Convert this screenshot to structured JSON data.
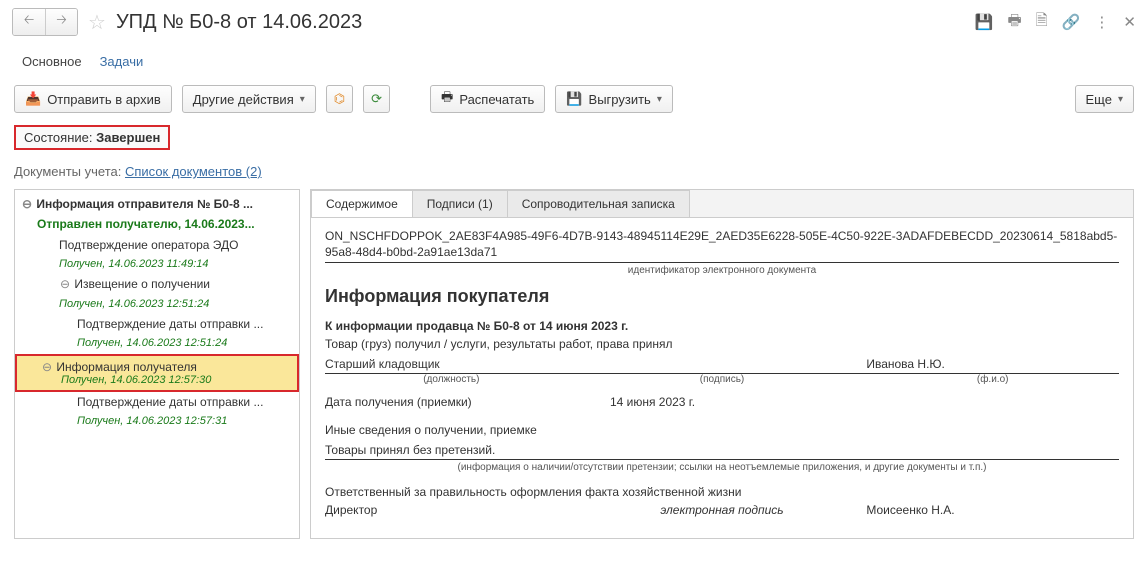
{
  "header": {
    "title": "УПД № Б0-8 от 14.06.2023"
  },
  "navtabs": {
    "main": "Основное",
    "tasks": "Задачи"
  },
  "toolbar": {
    "archive": "Отправить в архив",
    "other": "Другие действия",
    "print": "Распечатать",
    "export": "Выгрузить",
    "more": "Еще"
  },
  "status": {
    "label": "Состояние:",
    "value": "Завершен"
  },
  "docs": {
    "label": "Документы учета:",
    "link": "Список документов (2)"
  },
  "tree": {
    "root": "Информация отправителя № Б0-8 ...",
    "sent": "Отправлен получателю, 14.06.2023...",
    "n1": "Подтверждение оператора ЭДО",
    "n1s": "Получен, 14.06.2023 11:49:14",
    "n2": "Извещение о получении",
    "n2s": "Получен, 14.06.2023 12:51:24",
    "n3": "Подтверждение даты отправки ...",
    "n3s": "Получен, 14.06.2023 12:51:24",
    "sel": "Информация получателя",
    "sels": "Получен, 14.06.2023 12:57:30",
    "n4": "Подтверждение даты отправки ...",
    "n4s": "Получен, 14.06.2023 12:57:31"
  },
  "tabs": {
    "content": "Содержимое",
    "sigs": "Подписи (1)",
    "note": "Сопроводительная записка"
  },
  "doc": {
    "id": "ON_NSCHFDOPPOK_2AE83F4A985-49F6-4D7B-9143-48945114E29E_2AED35E6228-505E-4C50-922E-3ADAFDEBECDD_20230614_5818abd5-95a8-48d4-b0bd-2a91ae13da71",
    "idcap": "идентификатор электронного документа",
    "h2": "Информация покупателя",
    "sub": "К информации продавца № Б0-8 от 14 июня 2023 г.",
    "goods": "Товар (груз) получил / услуги, результаты работ, права принял",
    "position": "Старший кладовщик",
    "fio": "Иванова Н.Ю.",
    "cap_pos": "(должность)",
    "cap_sig": "(подпись)",
    "cap_fio": "(ф.и.о)",
    "daterow_lbl": "Дата получения (приемки)",
    "daterow_val": "14 июня 2023 г.",
    "other_lbl": "Иные сведения о получении, приемке",
    "other_val": "Товары принял без претензий.",
    "other_cap": "(информация о наличии/отсутствии претензии; ссылки на неотъемлемые приложения, и другие документы и т.п.)",
    "resp_lbl": "Ответственный за правильность оформления факта хозяйственной жизни",
    "resp_pos": "Директор",
    "resp_sig": "электронная подпись",
    "resp_fio": "Моисеенко Н.А."
  }
}
